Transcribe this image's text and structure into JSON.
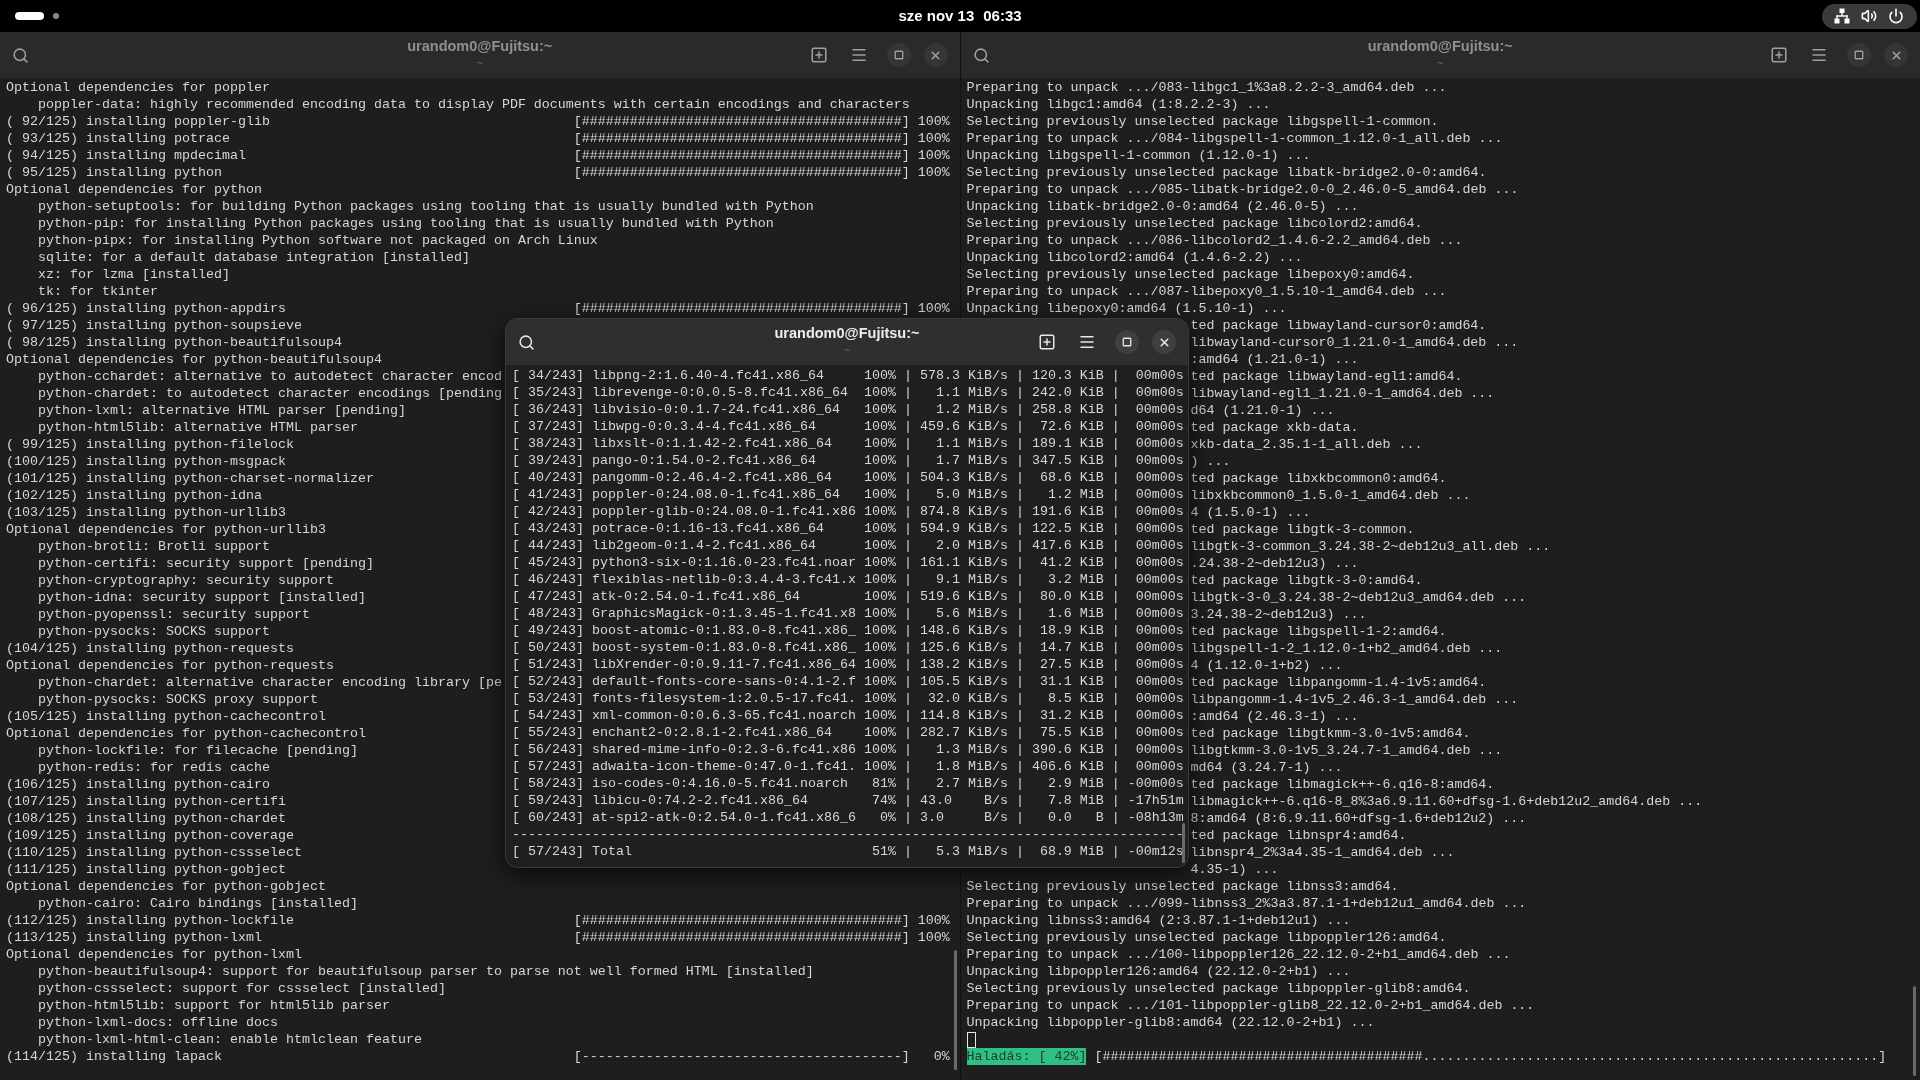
{
  "top_bar": {
    "date": "sze nov 13",
    "time": "06:33"
  },
  "windows": [
    {
      "title": "urandom0@Fujitsu:~",
      "subtitle": "~",
      "focused": false,
      "lines": [
        {
          "kind": "text",
          "text": "Optional dependencies for poppler",
          "children": [
            {
              "text": "poppler-data: highly recommended encoding data to display PDF documents with certain encodings and characters"
            }
          ]
        },
        {
          "kind": "progress",
          "text": "( 92/125) installing poppler-glib",
          "bar": "[########################################]",
          "percent": "100%"
        },
        {
          "kind": "progress",
          "text": "( 93/125) installing potrace",
          "bar": "[########################################]",
          "percent": "100%"
        },
        {
          "kind": "progress",
          "text": "( 94/125) installing mpdecimal",
          "bar": "[########################################]",
          "percent": "100%"
        },
        {
          "kind": "progress",
          "text": "( 95/125) installing python",
          "bar": "[########################################]",
          "percent": "100%"
        },
        {
          "kind": "text",
          "text": "Optional dependencies for python",
          "children": [
            {
              "text": "python-setuptools: for building Python packages using tooling that is usually bundled with Python"
            },
            {
              "text": "python-pip: for installing Python packages using tooling that is usually bundled with Python"
            },
            {
              "text": "python-pipx: for installing Python software not packaged on Arch Linux"
            },
            {
              "text": "sqlite: for a default database integration [installed]"
            },
            {
              "text": "xz: for lzma [installed]"
            },
            {
              "text": "tk: for tkinter"
            }
          ]
        },
        {
          "kind": "progress",
          "text": "( 96/125) installing python-appdirs",
          "bar": "[########################################]",
          "percent": "100%"
        },
        {
          "kind": "text",
          "text": "( 97/125) installing python-soupsieve"
        },
        {
          "kind": "text",
          "text": "( 98/125) installing python-beautifulsoup4"
        },
        {
          "kind": "text",
          "text": "Optional dependencies for python-beautifulsoup4",
          "children": [
            {
              "text": "python-cchardet: alternative to autodetect character encod"
            },
            {
              "text": "python-chardet: to autodetect character encodings [pending"
            },
            {
              "text": "python-lxml: alternative HTML parser [pending]"
            },
            {
              "text": "python-html5lib: alternative HTML parser"
            }
          ]
        },
        {
          "kind": "text",
          "text": "( 99/125) installing python-filelock"
        },
        {
          "kind": "text",
          "text": "(100/125) installing python-msgpack"
        },
        {
          "kind": "text",
          "text": "(101/125) installing python-charset-normalizer"
        },
        {
          "kind": "text",
          "text": "(102/125) installing python-idna"
        },
        {
          "kind": "text",
          "text": "(103/125) installing python-urllib3"
        },
        {
          "kind": "text",
          "text": "Optional dependencies for python-urllib3",
          "children": [
            {
              "text": "python-brotli: Brotli support"
            },
            {
              "text": "python-certifi: security support [pending]"
            },
            {
              "text": "python-cryptography: security support"
            },
            {
              "text": "python-idna: security support [installed]"
            },
            {
              "text": "python-pyopenssl: security support"
            },
            {
              "text": "python-pysocks: SOCKS support"
            }
          ]
        },
        {
          "kind": "text",
          "text": "(104/125) installing python-requests"
        },
        {
          "kind": "text",
          "text": "Optional dependencies for python-requests",
          "children": [
            {
              "text": "python-chardet: alternative character encoding library [pe"
            },
            {
              "text": "python-pysocks: SOCKS proxy support"
            }
          ]
        },
        {
          "kind": "text",
          "text": "(105/125) installing python-cachecontrol"
        },
        {
          "kind": "text",
          "text": "Optional dependencies for python-cachecontrol",
          "children": [
            {
              "text": "python-lockfile: for filecache [pending]"
            },
            {
              "text": "python-redis: for redis cache"
            }
          ]
        },
        {
          "kind": "text",
          "text": "(106/125) installing python-cairo"
        },
        {
          "kind": "text",
          "text": "(107/125) installing python-certifi"
        },
        {
          "kind": "text",
          "text": "(108/125) installing python-chardet"
        },
        {
          "kind": "text",
          "text": "(109/125) installing python-coverage"
        },
        {
          "kind": "text",
          "text": "(110/125) installing python-cssselect"
        },
        {
          "kind": "text",
          "text": "(111/125) installing python-gobject"
        },
        {
          "kind": "text",
          "text": "Optional dependencies for python-gobject",
          "children": [
            {
              "text": "python-cairo: Cairo bindings [installed]"
            }
          ]
        },
        {
          "kind": "progress",
          "text": "(112/125) installing python-lockfile",
          "bar": "[########################################]",
          "percent": "100%"
        },
        {
          "kind": "progress",
          "text": "(113/125) installing python-lxml",
          "bar": "[########################################]",
          "percent": "100%"
        },
        {
          "kind": "text",
          "text": "Optional dependencies for python-lxml",
          "children": [
            {
              "text": "python-beautifulsoup4: support for beautifulsoup parser to parse not well formed HTML [installed]"
            },
            {
              "text": "python-cssselect: support for cssselect [installed]"
            },
            {
              "text": "python-html5lib: support for html5lib parser"
            },
            {
              "text": "python-lxml-docs: offline docs"
            },
            {
              "text": "python-lxml-html-clean: enable htmlclean feature"
            }
          ]
        },
        {
          "kind": "progress",
          "text": "(114/125) installing lapack",
          "bar": "[----------------------------------------]",
          "percent": "0%"
        }
      ]
    },
    {
      "title": "urandom0@Fujitsu:~",
      "subtitle": "~",
      "focused": false,
      "lines": [
        {
          "kind": "text",
          "text": "Preparing to unpack .../083-libgc1_1%3a8.2.2-3_amd64.deb ..."
        },
        {
          "kind": "text",
          "text": "Unpacking libgc1:amd64 (1:8.2.2-3) ..."
        },
        {
          "kind": "text",
          "text": "Selecting previously unselected package libgspell-1-common."
        },
        {
          "kind": "text",
          "text": "Preparing to unpack .../084-libgspell-1-common_1.12.0-1_all.deb ..."
        },
        {
          "kind": "text",
          "text": "Unpacking libgspell-1-common (1.12.0-1) ..."
        },
        {
          "kind": "text",
          "text": "Selecting previously unselected package libatk-bridge2.0-0:amd64."
        },
        {
          "kind": "text",
          "text": "Preparing to unpack .../085-libatk-bridge2.0-0_2.46.0-5_amd64.deb ..."
        },
        {
          "kind": "text",
          "text": "Unpacking libatk-bridge2.0-0:amd64 (2.46.0-5) ..."
        },
        {
          "kind": "text",
          "text": "Selecting previously unselected package libcolord2:amd64."
        },
        {
          "kind": "text",
          "text": "Preparing to unpack .../086-libcolord2_1.4.6-2.2_amd64.deb ..."
        },
        {
          "kind": "text",
          "text": "Unpacking libcolord2:amd64 (1.4.6-2.2) ..."
        },
        {
          "kind": "text",
          "text": "Selecting previously unselected package libepoxy0:amd64."
        },
        {
          "kind": "text",
          "text": "Preparing to unpack .../087-libepoxy0_1.5.10-1_amd64.deb ..."
        },
        {
          "kind": "text",
          "text": "Unpacking libepoxy0:amd64 (1.5.10-1) ..."
        },
        {
          "kind": "clipped",
          "text": "ted package libwayland-cursor0:amd64."
        },
        {
          "kind": "clipped",
          "text": "libwayland-cursor0_1.21.0-1_amd64.deb ..."
        },
        {
          "kind": "clipped",
          "text": ":amd64 (1.21.0-1) ..."
        },
        {
          "kind": "clipped",
          "text": "ted package libwayland-egl1:amd64."
        },
        {
          "kind": "clipped",
          "text": "libwayland-egl1_1.21.0-1_amd64.deb ..."
        },
        {
          "kind": "clipped",
          "text": "d64 (1.21.0-1) ..."
        },
        {
          "kind": "clipped",
          "text": "ted package xkb-data."
        },
        {
          "kind": "clipped",
          "text": "xkb-data_2.35.1-1_all.deb ..."
        },
        {
          "kind": "clipped",
          "text": ") ..."
        },
        {
          "kind": "clipped",
          "text": "ted package libxkbcommon0:amd64."
        },
        {
          "kind": "clipped",
          "text": "libxkbcommon0_1.5.0-1_amd64.deb ..."
        },
        {
          "kind": "clipped",
          "text": "4 (1.5.0-1) ..."
        },
        {
          "kind": "clipped",
          "text": "ted package libgtk-3-common."
        },
        {
          "kind": "clipped",
          "text": "libgtk-3-common_3.24.38-2~deb12u3_all.deb ..."
        },
        {
          "kind": "clipped",
          "text": ".24.38-2~deb12u3) ..."
        },
        {
          "kind": "clipped",
          "text": "ted package libgtk-3-0:amd64."
        },
        {
          "kind": "clipped",
          "text": "libgtk-3-0_3.24.38-2~deb12u3_amd64.deb ..."
        },
        {
          "kind": "clipped",
          "text": "3.24.38-2~deb12u3) ..."
        },
        {
          "kind": "clipped",
          "text": "ted package libgspell-1-2:amd64."
        },
        {
          "kind": "clipped",
          "text": "libgspell-1-2_1.12.0-1+b2_amd64.deb ..."
        },
        {
          "kind": "clipped",
          "text": "4 (1.12.0-1+b2) ..."
        },
        {
          "kind": "clipped",
          "text": "ted package libpangomm-1.4-1v5:amd64."
        },
        {
          "kind": "clipped",
          "text": "libpangomm-1.4-1v5_2.46.3-1_amd64.deb ..."
        },
        {
          "kind": "clipped",
          "text": ":amd64 (2.46.3-1) ..."
        },
        {
          "kind": "clipped",
          "text": "ted package libgtkmm-3.0-1v5:amd64."
        },
        {
          "kind": "clipped",
          "text": "libgtkmm-3.0-1v5_3.24.7-1_amd64.deb ..."
        },
        {
          "kind": "clipped",
          "text": "md64 (3.24.7-1) ..."
        },
        {
          "kind": "clipped",
          "text": "ted package libmagick++-6.q16-8:amd64."
        },
        {
          "kind": "clipped",
          "text": "libmagick++-6.q16-8_8%3a6.9.11.60+dfsg-1.6+deb12u2_amd64.deb ..."
        },
        {
          "kind": "clipped",
          "text": "8:amd64 (8:6.9.11.60+dfsg-1.6+deb12u2) ..."
        },
        {
          "kind": "clipped",
          "text": "ted package libnspr4:amd64."
        },
        {
          "kind": "clipped",
          "text": "libnspr4_2%3a4.35-1_amd64.deb ..."
        },
        {
          "kind": "clipped",
          "text": "4.35-1) ..."
        },
        {
          "kind": "text",
          "text": "Selecting previously unselected package libnss3:amd64."
        },
        {
          "kind": "text",
          "text": "Preparing to unpack .../099-libnss3_2%3a3.87.1-1+deb12u1_amd64.deb ..."
        },
        {
          "kind": "text",
          "text": "Unpacking libnss3:amd64 (2:3.87.1-1+deb12u1) ..."
        },
        {
          "kind": "text",
          "text": "Selecting previously unselected package libpoppler126:amd64."
        },
        {
          "kind": "text",
          "text": "Preparing to unpack .../100-libpoppler126_22.12.0-2+b1_amd64.deb ..."
        },
        {
          "kind": "text",
          "text": "Unpacking libpoppler126:amd64 (22.12.0-2+b1) ..."
        },
        {
          "kind": "text",
          "text": "Selecting previously unselected package libpoppler-glib8:amd64."
        },
        {
          "kind": "text",
          "text": "Preparing to unpack .../101-libpoppler-glib8_22.12.0-2+b1_amd64.deb ..."
        },
        {
          "kind": "text",
          "text": "Unpacking libpoppler-glib8:amd64 (22.12.0-2+b1) ..."
        },
        {
          "kind": "cursor"
        },
        {
          "kind": "status",
          "label": "Haladás: [ 42%]",
          "bar": "[########################################.........................................................]"
        }
      ]
    }
  ],
  "floating_window": {
    "title": "urandom0@Fujitsu:~",
    "subtitle": "~",
    "focused": true,
    "lines": [
      "[ 34/243] libpng-2:1.6.40-4.fc41.x86_64     100% | 578.3 KiB/s | 120.3 KiB |  00m00s",
      "[ 35/243] librevenge-0:0.0.5-8.fc41.x86_64  100% |   1.1 MiB/s | 242.0 KiB |  00m00s",
      "[ 36/243] libvisio-0:0.1.7-24.fc41.x86_64   100% |   1.2 MiB/s | 258.8 KiB |  00m00s",
      "[ 37/243] libwpg-0:0.3.4-4.fc41.x86_64      100% | 459.6 KiB/s |  72.6 KiB |  00m00s",
      "[ 38/243] libxslt-0:1.1.42-2.fc41.x86_64    100% |   1.1 MiB/s | 189.1 KiB |  00m00s",
      "[ 39/243] pango-0:1.54.0-2.fc41.x86_64      100% |   1.7 MiB/s | 347.5 KiB |  00m00s",
      "[ 40/243] pangomm-0:2.46.4-2.fc41.x86_64    100% | 504.3 KiB/s |  68.6 KiB |  00m00s",
      "[ 41/243] poppler-0:24.08.0-1.fc41.x86_64   100% |   5.0 MiB/s |   1.2 MiB |  00m00s",
      "[ 42/243] poppler-glib-0:24.08.0-1.fc41.x86 100% | 874.8 KiB/s | 191.6 KiB |  00m00s",
      "[ 43/243] potrace-0:1.16-13.fc41.x86_64     100% | 594.9 KiB/s | 122.5 KiB |  00m00s",
      "[ 44/243] lib2geom-0:1.4-2.fc41.x86_64      100% |   2.0 MiB/s | 417.6 KiB |  00m00s",
      "[ 45/243] python3-six-0:1.16.0-23.fc41.noar 100% | 161.1 KiB/s |  41.2 KiB |  00m00s",
      "[ 46/243] flexiblas-netlib-0:3.4.4-3.fc41.x 100% |   9.1 MiB/s |   3.2 MiB |  00m00s",
      "[ 47/243] atk-0:2.54.0-1.fc41.x86_64        100% | 519.6 KiB/s |  80.0 KiB |  00m00s",
      "[ 48/243] GraphicsMagick-0:1.3.45-1.fc41.x8 100% |   5.6 MiB/s |   1.6 MiB |  00m00s",
      "[ 49/243] boost-atomic-0:1.83.0-8.fc41.x86_ 100% | 148.6 KiB/s |  18.9 KiB |  00m00s",
      "[ 50/243] boost-system-0:1.83.0-8.fc41.x86_ 100% | 125.6 KiB/s |  14.7 KiB |  00m00s",
      "[ 51/243] libXrender-0:0.9.11-7.fc41.x86_64 100% | 138.2 KiB/s |  27.5 KiB |  00m00s",
      "[ 52/243] default-fonts-core-sans-0:4.1-2.f 100% | 105.5 KiB/s |  31.1 KiB |  00m00s",
      "[ 53/243] fonts-filesystem-1:2.0.5-17.fc41. 100% |  32.0 KiB/s |   8.5 KiB |  00m00s",
      "[ 54/243] xml-common-0:0.6.3-65.fc41.noarch 100% | 114.8 KiB/s |  31.2 KiB |  00m00s",
      "[ 55/243] enchant2-0:2.8.1-2.fc41.x86_64    100% | 282.7 KiB/s |  75.5 KiB |  00m00s",
      "[ 56/243] shared-mime-info-0:2.3-6.fc41.x86 100% |   1.3 MiB/s | 390.6 KiB |  00m00s",
      "[ 57/243] adwaita-icon-theme-0:47.0-1.fc41. 100% |   1.8 MiB/s | 406.6 KiB |  00m00s",
      "[ 58/243] iso-codes-0:4.16.0-5.fc41.noarch   81% |   2.7 MiB/s |   2.9 MiB | -00m00s",
      "[ 59/243] libicu-0:74.2-2.fc41.x86_64        74% | 43.0    B/s |   7.8 MiB | -17h51m",
      "[ 60/243] at-spi2-atk-0:2.54.0-1.fc41.x86_6   0% | 3.0     B/s |   0.0   B | -08h13m",
      "------------------------------------------------------------------------------------",
      "[ 57/243] Total                              51% |   5.3 MiB/s |  68.9 MiB | -00m12s"
    ]
  }
}
